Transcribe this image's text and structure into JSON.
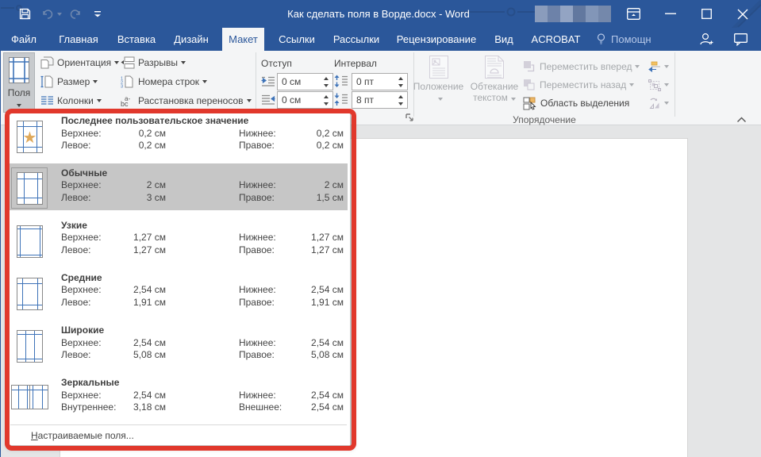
{
  "colors": {
    "accent": "#2b579a",
    "ribbon_bg": "#f4f5f6",
    "annotation_red": "#e1382c",
    "selected_row": "#c6c6c6",
    "icon_blue": "#3e73b8",
    "star_gold": "#dfa95b"
  },
  "title_bar": {
    "title": "Как сделать поля в Ворде.docx - Word",
    "icons": [
      "save",
      "undo",
      "redo",
      "customize-quick-access"
    ]
  },
  "tabs": {
    "items": [
      "Файл",
      "Главная",
      "Вставка",
      "Дизайн",
      "Макет",
      "Ссылки",
      "Рассылки",
      "Рецензирование",
      "Вид",
      "ACROBAT"
    ],
    "active": "Макет",
    "tellme": "Помощн"
  },
  "ribbon": {
    "page_setup": {
      "margins_button": "Поля",
      "orientation": "Ориентация",
      "size": "Размер",
      "columns": "Колонки",
      "breaks": "Разрывы",
      "line_numbers": "Номера строк",
      "hyphenation": "Расстановка переносов"
    },
    "paragraph": {
      "indent_label": "Отступ",
      "indent_left_value": "0 см",
      "indent_right_value": "0 см",
      "spacing_label": "Интервал",
      "spacing_before_value": "0 пт",
      "spacing_after_value": "8 пт"
    },
    "arrange": {
      "position": "Положение",
      "wrap_line1": "Обтекание",
      "wrap_line2": "текстом",
      "bring_forward": "Переместить вперед",
      "send_backward": "Переместить назад",
      "selection_pane": "Область выделения",
      "group_label": "Упорядочение"
    }
  },
  "dropdown": {
    "presets": [
      {
        "title": "Последнее пользовательское значение",
        "rows": [
          [
            "Верхнее:",
            "0,2 см",
            "Нижнее:",
            "0,2 см"
          ],
          [
            "Левое:",
            "0,2 см",
            "Правое:",
            "0,2 см"
          ]
        ]
      },
      {
        "title": "Обычные",
        "rows": [
          [
            "Верхнее:",
            "2 см",
            "Нижнее:",
            "2 см"
          ],
          [
            "Левое:",
            "3 см",
            "Правое:",
            "1,5 см"
          ]
        ]
      },
      {
        "title": "Узкие",
        "rows": [
          [
            "Верхнее:",
            "1,27 см",
            "Нижнее:",
            "1,27 см"
          ],
          [
            "Левое:",
            "1,27 см",
            "Правое:",
            "1,27 см"
          ]
        ]
      },
      {
        "title": "Средние",
        "rows": [
          [
            "Верхнее:",
            "2,54 см",
            "Нижнее:",
            "2,54 см"
          ],
          [
            "Левое:",
            "1,91 см",
            "Правое:",
            "1,91 см"
          ]
        ]
      },
      {
        "title": "Широкие",
        "rows": [
          [
            "Верхнее:",
            "2,54 см",
            "Нижнее:",
            "2,54 см"
          ],
          [
            "Левое:",
            "5,08 см",
            "Правое:",
            "5,08 см"
          ]
        ]
      },
      {
        "title": "Зеркальные",
        "rows": [
          [
            "Верхнее:",
            "2,54 см",
            "Нижнее:",
            "2,54 см"
          ],
          [
            "Внутреннее:",
            "3,18 см",
            "Внешнее:",
            "2,54 см"
          ]
        ]
      }
    ],
    "selected": "Обычные",
    "custom_item_prefix": "Н",
    "custom_item_rest": "астраиваемые поля..."
  }
}
